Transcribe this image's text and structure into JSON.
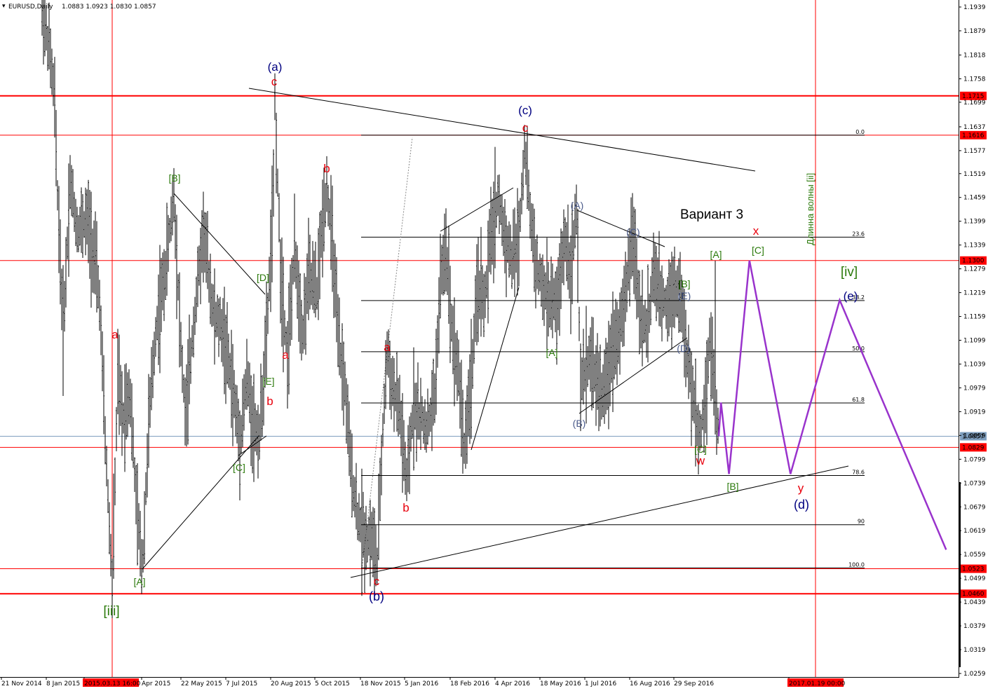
{
  "chart_data": {
    "type": "line",
    "header": {
      "symbol": "EURUSD,Daily",
      "ohlc": "1.0883 1.0923 1.0830 1.0857"
    },
    "y_axis": {
      "ticks": [
        "1.1939",
        "1.1879",
        "1.1818",
        "1.1758",
        "1.1699",
        "1.1637",
        "1.1577",
        "1.1519",
        "1.1459",
        "1.1399",
        "1.1339",
        "1.1279",
        "1.1219",
        "1.1159",
        "1.1099",
        "1.1039",
        "1.0979",
        "1.0919",
        "1.0859",
        "1.0799",
        "1.0739",
        "1.0679",
        "1.0619",
        "1.0559",
        "1.0499",
        "1.0439",
        "1.0379",
        "1.0319",
        "1.0259"
      ],
      "range": [
        1.0259,
        1.1939
      ]
    },
    "x_axis": {
      "ticks": [
        "21 Nov 2014",
        "8 Jan 2015",
        "2015.03.13 16:00",
        "Apr 2015",
        "22 May 2015",
        "7 Jul 2015",
        "20 Aug 2015",
        "5 Oct 2015",
        "18 Nov 2015",
        "5 Jan 2016",
        "18 Feb 2016",
        "4 Apr 2016",
        "18 May 2016",
        "1 Jul 2016",
        "16 Aug 2016",
        "29 Sep 2016",
        "2017.01.19 00:00"
      ]
    },
    "horizontal_levels": [
      {
        "price": 1.1715,
        "label": "1.1715",
        "color": "#ff0000"
      },
      {
        "price": 1.1616,
        "label": "1.1616",
        "color": "#ff0000"
      },
      {
        "price": 1.13,
        "label": "1.1300",
        "color": "#ff0000"
      },
      {
        "price": 1.0857,
        "label": "1.0857",
        "color": "#7f9fbf"
      },
      {
        "price": 1.0829,
        "label": "1.0829",
        "color": "#ff0000"
      },
      {
        "price": 1.0523,
        "label": "1.0523",
        "color": "#ff0000"
      },
      {
        "price": 1.046,
        "label": "1.0460",
        "color": "#ff0000"
      }
    ],
    "fib_levels": [
      {
        "label": "0.0",
        "price": 1.1616
      },
      {
        "label": "23.6",
        "price": 1.1359
      },
      {
        "label": "38.2",
        "price": 1.1199
      },
      {
        "label": "50.0",
        "price": 1.107
      },
      {
        "label": "61.8",
        "price": 1.0941
      },
      {
        "label": "78.6",
        "price": 1.0758
      },
      {
        "label": "90",
        "price": 1.0634
      },
      {
        "label": "100.0",
        "price": 1.0525
      }
    ],
    "forecast_path": [
      {
        "date": "2016-10-26",
        "price": 1.0857
      },
      {
        "date": "2016-10-28",
        "price": 1.0942
      },
      {
        "date": "2016-11-04",
        "price": 1.0762
      },
      {
        "date": "2016-11-22",
        "price": 1.13
      },
      {
        "date": "2016-12-28",
        "price": 1.0762
      },
      {
        "date": "2017-01-29",
        "price": 1.12
      },
      {
        "date": "2017-03-14",
        "price": 1.0571
      }
    ],
    "annotations": {
      "variant": "Вариант 3",
      "wave_length": "Длинна волны [ii]",
      "wave_labels": [
        "(a)",
        "c",
        "(c)",
        "c",
        "[B]",
        "b",
        "[D]",
        "a",
        "[E]",
        "b",
        "[C]",
        "[A]",
        "[iii]",
        "a",
        "a",
        "b",
        "c",
        "(b)",
        "(A)",
        "(C)",
        "[B]",
        "(E)",
        "[A]",
        "[A]",
        "(D)",
        "(B)",
        "[C]",
        "w",
        "x",
        "[C]",
        "[iv]",
        "(e)",
        "[B]",
        "y",
        "(d)"
      ]
    },
    "colors": {
      "candles": "#000000",
      "levels": "#ff0000",
      "forecast": "#9933cc",
      "label_red": "#e8000c",
      "label_navy": "#000080",
      "label_green": "#2b7a0b",
      "label_slate": "#4a5a8a"
    }
  }
}
